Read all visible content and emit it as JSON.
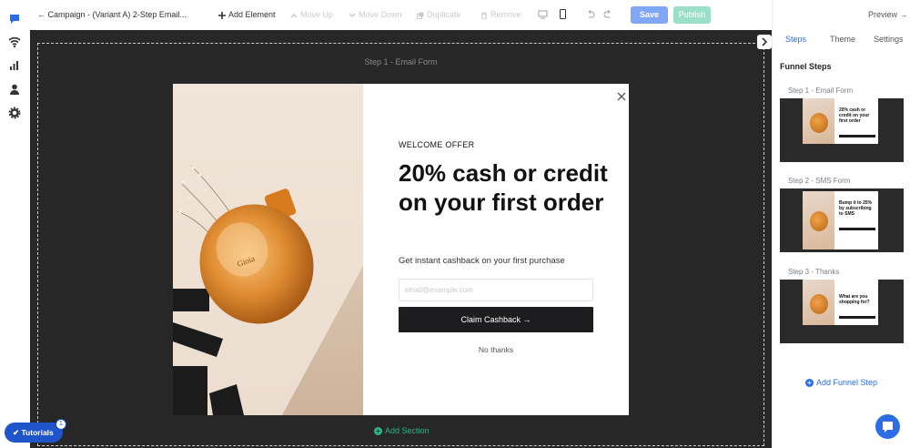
{
  "topbar": {
    "back_label": "← Campaign - (Variant A) 2-Step Email...",
    "add_element": "Add Element",
    "move_up": "Move Up",
    "move_down": "Move Down",
    "duplicate": "Duplicate",
    "remove": "Remove",
    "save": "Save",
    "publish": "Publish",
    "preview": "Preview →"
  },
  "canvas": {
    "step_label": "Step 1 - Email Form",
    "add_section": "Add Section"
  },
  "popup": {
    "kicker": "WELCOME OFFER",
    "headline": "20% cash or credit on your first order",
    "subtitle": "Get instant cashback on your first purchase",
    "email_placeholder": "email@example.com",
    "cta": "Claim Cashback →",
    "decline": "No thanks"
  },
  "panel": {
    "tabs": [
      "Steps",
      "Theme",
      "Settings"
    ],
    "active_tab": "Steps",
    "heading": "Funnel Steps",
    "steps": [
      {
        "label": "Step 1 - Email Form",
        "thumb_text": "20% cash or credit on your first order"
      },
      {
        "label": "Step 2 - SMS Form",
        "thumb_text": "Bump it to 25% by subscribing to SMS"
      },
      {
        "label": "Step 3 - Thanks",
        "thumb_text": "What are you shopping for?"
      }
    ],
    "add_step": "Add Funnel Step"
  },
  "tutorials": {
    "label": "Tutorials",
    "badge": "1"
  },
  "colors": {
    "accent": "#2c6ce6",
    "canvas_bg": "#272727",
    "publish": "#9ae0c8",
    "save": "#82a6f6",
    "add_section": "#2bb38a"
  },
  "icons": [
    "chat-icon",
    "wifi-icon",
    "bar-chart-icon",
    "user-icon",
    "gear-icon",
    "desktop-icon",
    "mobile-icon",
    "undo-icon",
    "redo-icon",
    "close-icon",
    "chevron-right-icon",
    "plus-circle-icon"
  ]
}
